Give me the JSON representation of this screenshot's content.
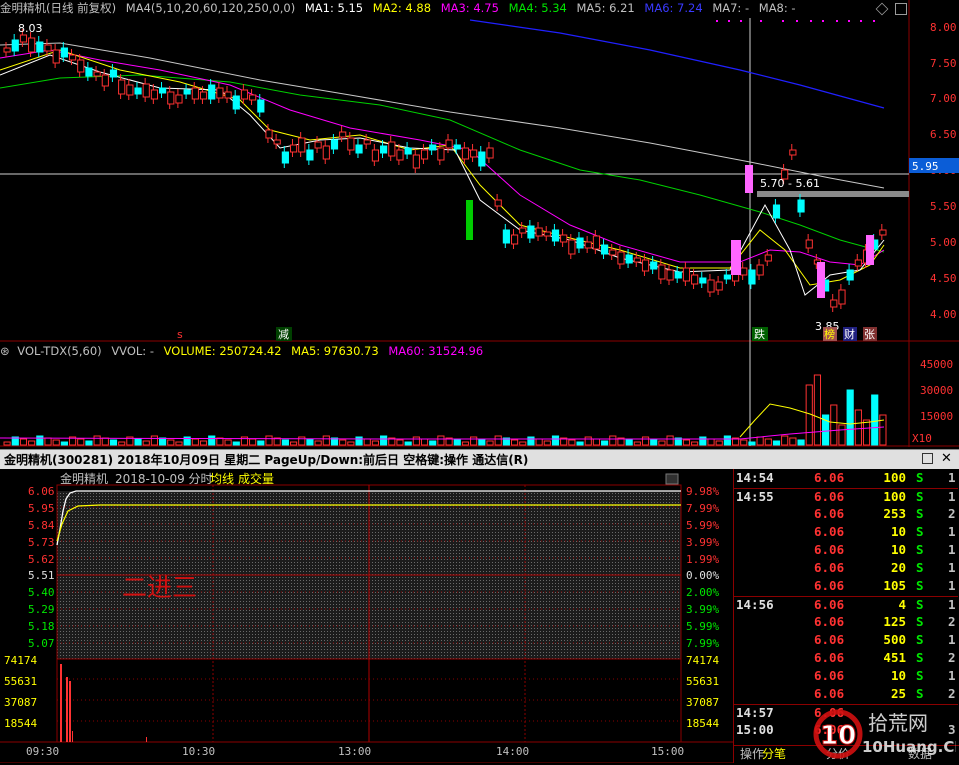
{
  "kline": {
    "header": {
      "stock": "金明精机(日线 前复权)",
      "ma_def": "MA4(5,10,20,60,120,250,0,0)",
      "ma1": "MA1: 5.15",
      "ma2": "MA2: 4.88",
      "ma3": "MA3: 4.75",
      "ma4": "MA4: 5.34",
      "ma5": "MA5: 6.21",
      "ma6": "MA6: 7.24",
      "ma7": "MA7: -",
      "ma8": "MA8: -"
    },
    "price_ticks": [
      "8.00",
      "7.50",
      "7.00",
      "6.50",
      "6.00",
      "5.50",
      "5.00",
      "4.50",
      "4.00"
    ],
    "crosshair_price": "5.95",
    "high_label": "8.03",
    "low_label": "3.85",
    "range_label": "5.70 - 5.61",
    "markers": {
      "s": "s",
      "jian": "减",
      "die": "跌",
      "bang": "榜",
      "cai": "财",
      "zhang": "张"
    },
    "colors": {
      "up": "#ff3232",
      "down": "#00ffff",
      "ma5": "#ffffff",
      "ma10": "#ffff00",
      "ma20": "#ff00ff",
      "ma60": "#00e600",
      "ma120": "#c0c0c0",
      "ma250": "#2020ff"
    }
  },
  "volume": {
    "header": {
      "name": "VOL-TDX(5,60)",
      "vvol": "VVOL: -",
      "volume": "VOLUME: 250724.42",
      "ma5": "MA5: 97630.73",
      "ma60": "MA60: 31524.96"
    },
    "ticks": [
      "45000",
      "30000",
      "15000"
    ],
    "unit": "X10"
  },
  "minute": {
    "title_bar": "金明精机(300281)  2018年10月09日 星期二  PageUp/Down:前后日  空格键:操作  通达信(R)",
    "chart_title": "金明精机",
    "chart_date": "2018-10-09 分时",
    "avg_label": "均线",
    "vol_label": "成交量",
    "annotation": "二进三",
    "price_ticks": [
      "6.06",
      "5.95",
      "5.84",
      "5.73",
      "5.62",
      "5.51",
      "5.40",
      "5.29",
      "5.18",
      "5.07"
    ],
    "pct_ticks": [
      "9.98%",
      "7.99%",
      "5.99%",
      "3.99%",
      "1.99%",
      "0.00%",
      "2.00%",
      "3.99%",
      "5.99%",
      "7.99%"
    ],
    "vol_ticks": [
      "74174",
      "55631",
      "37087",
      "18544"
    ],
    "time_ticks": [
      "09:30",
      "10:30",
      "13:00",
      "14:00",
      "15:00"
    ]
  },
  "ticks_panel": {
    "rows": [
      {
        "time": "14:54",
        "price": "6.06",
        "vol": "100",
        "side": "S",
        "n": "1"
      },
      {
        "time": "14:55",
        "price": "6.06",
        "vol": "100",
        "side": "S",
        "n": "1"
      },
      {
        "time": "",
        "price": "6.06",
        "vol": "253",
        "side": "S",
        "n": "2"
      },
      {
        "time": "",
        "price": "6.06",
        "vol": "10",
        "side": "S",
        "n": "1"
      },
      {
        "time": "",
        "price": "6.06",
        "vol": "10",
        "side": "S",
        "n": "1"
      },
      {
        "time": "",
        "price": "6.06",
        "vol": "20",
        "side": "S",
        "n": "1"
      },
      {
        "time": "",
        "price": "6.06",
        "vol": "105",
        "side": "S",
        "n": "1"
      },
      {
        "time": "14:56",
        "price": "6.06",
        "vol": "4",
        "side": "S",
        "n": "1"
      },
      {
        "time": "",
        "price": "6.06",
        "vol": "125",
        "side": "S",
        "n": "2"
      },
      {
        "time": "",
        "price": "6.06",
        "vol": "500",
        "side": "S",
        "n": "1"
      },
      {
        "time": "",
        "price": "6.06",
        "vol": "451",
        "side": "S",
        "n": "2"
      },
      {
        "time": "",
        "price": "6.06",
        "vol": "10",
        "side": "S",
        "n": "1"
      },
      {
        "time": "",
        "price": "6.06",
        "vol": "25",
        "side": "S",
        "n": "2"
      },
      {
        "time": "14:57",
        "price": "6.06",
        "vol": "",
        "side": "",
        "n": ""
      },
      {
        "time": "15:00",
        "price": "6.06",
        "vol": "",
        "side": "",
        "n": "3"
      }
    ],
    "tabs": {
      "op": "操作",
      "fenbi": "分笔",
      "fenjia": "分价",
      "shuju": "数据"
    }
  },
  "watermark": {
    "num": "10",
    "cn": "拾荒网",
    "url": "10Huang.CN"
  }
}
